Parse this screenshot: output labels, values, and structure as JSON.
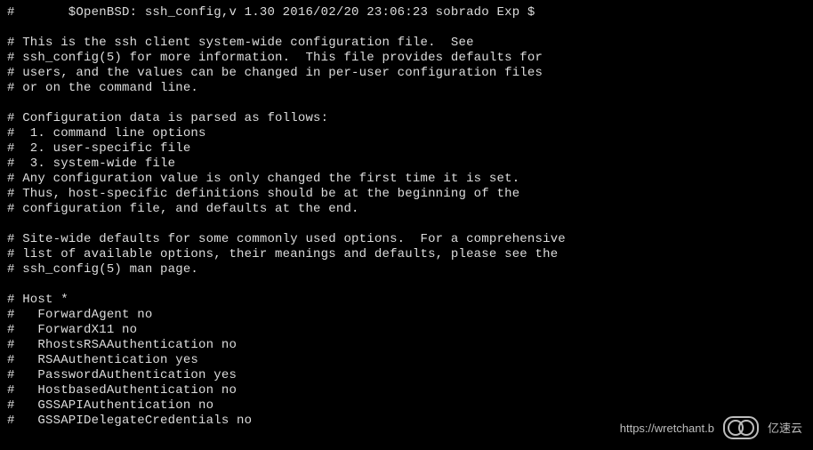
{
  "terminal": {
    "lines": [
      "#       $OpenBSD: ssh_config,v 1.30 2016/02/20 23:06:23 sobrado Exp $",
      "",
      "# This is the ssh client system-wide configuration file.  See",
      "# ssh_config(5) for more information.  This file provides defaults for",
      "# users, and the values can be changed in per-user configuration files",
      "# or on the command line.",
      "",
      "# Configuration data is parsed as follows:",
      "#  1. command line options",
      "#  2. user-specific file",
      "#  3. system-wide file",
      "# Any configuration value is only changed the first time it is set.",
      "# Thus, host-specific definitions should be at the beginning of the",
      "# configuration file, and defaults at the end.",
      "",
      "# Site-wide defaults for some commonly used options.  For a comprehensive",
      "# list of available options, their meanings and defaults, please see the",
      "# ssh_config(5) man page.",
      "",
      "# Host *",
      "#   ForwardAgent no",
      "#   ForwardX11 no",
      "#   RhostsRSAAuthentication no",
      "#   RSAAuthentication yes",
      "#   PasswordAuthentication yes",
      "#   HostbasedAuthentication no",
      "#   GSSAPIAuthentication no",
      "#   GSSAPIDelegateCredentials no"
    ]
  },
  "watermark": {
    "url": "https://wretchant.b",
    "brand": "亿速云"
  }
}
